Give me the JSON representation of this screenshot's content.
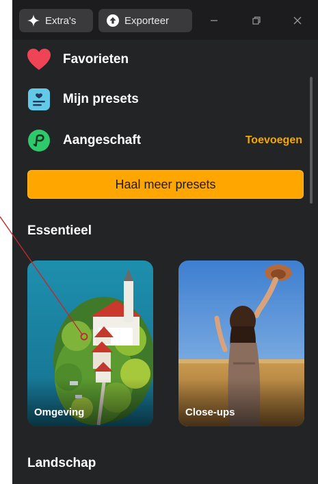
{
  "titlebar": {
    "extras_label": "Extra's",
    "export_label": "Exporteer"
  },
  "menu": {
    "favorites_label": "Favorieten",
    "my_presets_label": "Mijn presets",
    "purchased_label": "Aangeschaft",
    "add_label": "Toevoegen"
  },
  "get_more_label": "Haal meer presets",
  "sections": {
    "essential_title": "Essentieel",
    "landscape_title": "Landschap"
  },
  "cards": [
    {
      "label": "Omgeving"
    },
    {
      "label": "Close-ups"
    }
  ],
  "colors": {
    "accent": "#ffa600",
    "add_link": "#f5a800",
    "panel_bg": "#232426",
    "titlebar_bg": "#1c1c1e",
    "annotation": "#c0282e"
  },
  "icons": {
    "extras": "sparkle-icon",
    "export": "upload-circle-icon",
    "favorites": "heart-icon",
    "my_presets": "preset-list-icon",
    "purchased": "purchase-p-icon"
  }
}
